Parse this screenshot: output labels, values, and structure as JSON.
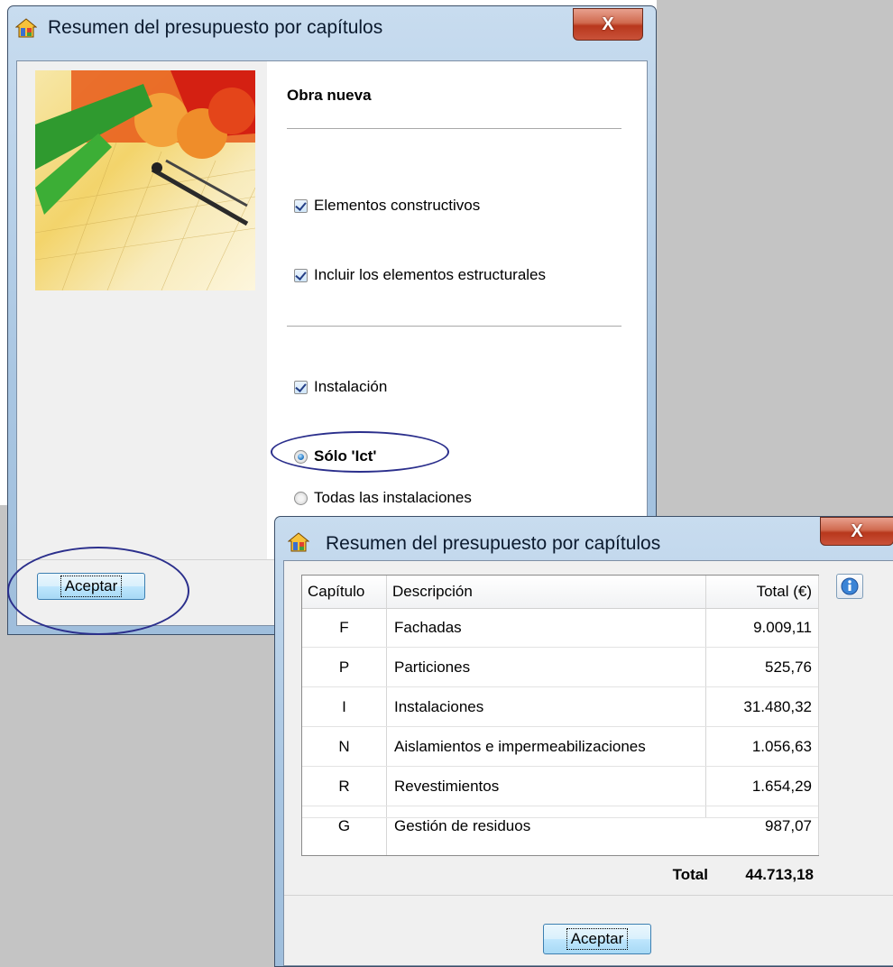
{
  "window1": {
    "title": "Resumen del presupuesto por capítulos",
    "close_label": "X",
    "section_title": "Obra nueva",
    "checkboxes": [
      {
        "label": "Elementos constructivos",
        "checked": true
      },
      {
        "label": "Incluir los elementos estructurales",
        "checked": true
      },
      {
        "label": "Instalación",
        "checked": true
      }
    ],
    "radios": [
      {
        "label": "Sólo 'Ict'",
        "selected": true
      },
      {
        "label": "Todas las instalaciones",
        "selected": false
      }
    ],
    "ok_label": "Aceptar"
  },
  "window2": {
    "title": "Resumen del presupuesto por capítulos",
    "close_label": "X",
    "columns": {
      "chapter": "Capítulo",
      "description": "Descripción",
      "total": "Total (€)"
    },
    "rows": [
      {
        "chapter": "F",
        "description": "Fachadas",
        "total": "9.009,11"
      },
      {
        "chapter": "P",
        "description": "Particiones",
        "total": "525,76"
      },
      {
        "chapter": "I",
        "description": "Instalaciones",
        "total": "31.480,32"
      },
      {
        "chapter": "N",
        "description": "Aislamientos e impermeabilizaciones",
        "total": "1.056,63"
      },
      {
        "chapter": "R",
        "description": "Revestimientos",
        "total": "1.654,29"
      },
      {
        "chapter": "G",
        "description": "Gestión de residuos",
        "total": "987,07"
      }
    ],
    "total_label": "Total",
    "total_value": "44.713,18",
    "ok_label": "Aceptar"
  },
  "colors": {
    "annotation": "#2b2f8c",
    "title_bar": "#a9c6e2",
    "close_button": "#c9523a"
  }
}
